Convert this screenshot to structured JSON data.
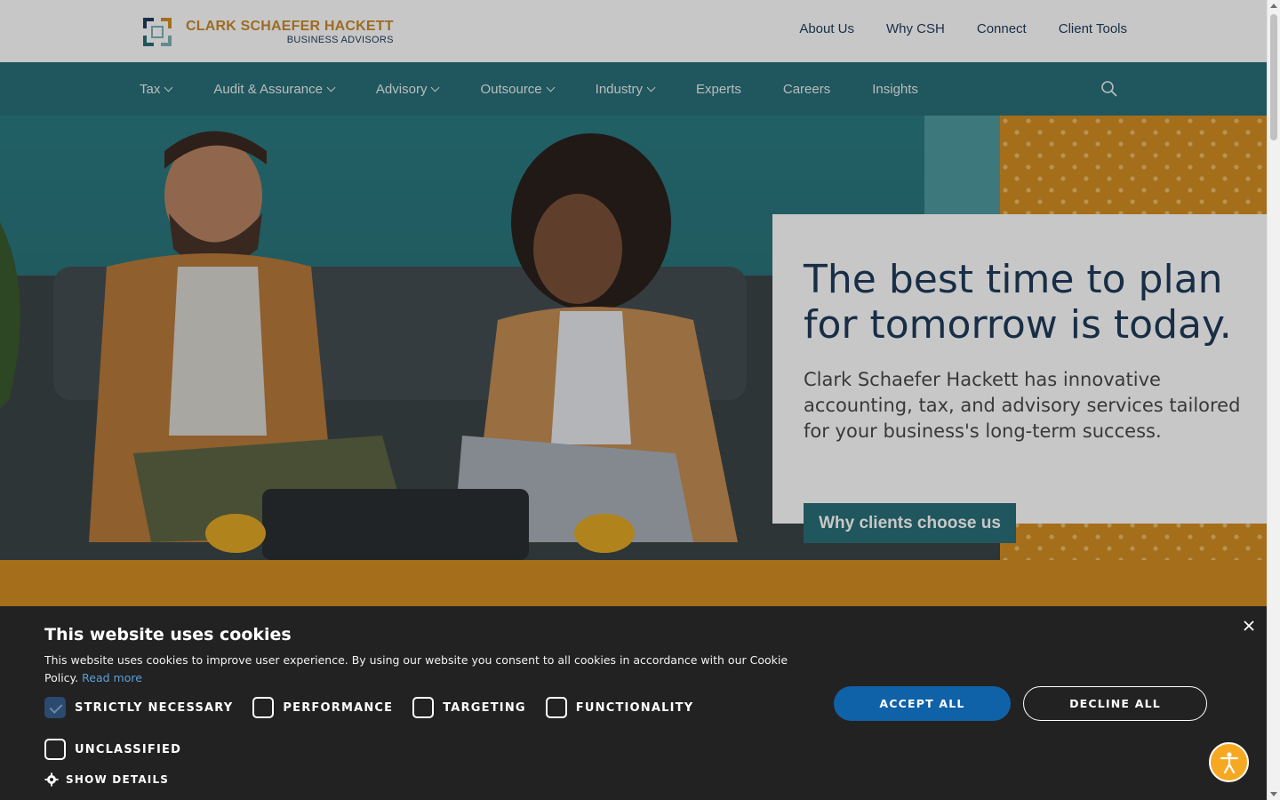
{
  "brand": {
    "name": "CLARK SCHAEFER HACKETT",
    "tagline": "BUSINESS ADVISORS"
  },
  "utility_nav": [
    "About Us",
    "Why CSH",
    "Connect",
    "Client Tools"
  ],
  "main_nav": [
    {
      "label": "Tax",
      "dropdown": true
    },
    {
      "label": "Audit & Assurance",
      "dropdown": true
    },
    {
      "label": "Advisory",
      "dropdown": true
    },
    {
      "label": "Outsource",
      "dropdown": true
    },
    {
      "label": "Industry",
      "dropdown": true
    },
    {
      "label": "Experts",
      "dropdown": false
    },
    {
      "label": "Careers",
      "dropdown": false
    },
    {
      "label": "Insights",
      "dropdown": false
    }
  ],
  "hero": {
    "title": "The best time to plan for tomorrow is today.",
    "text": "Clark Schaefer Hackett has innovative accounting, tax, and advisory services tailored for your business's long-term success.",
    "cta": "Why clients choose us"
  },
  "cookie": {
    "title": "This website uses cookies",
    "description": "This website uses cookies to improve user experience. By using our website you consent to all cookies in accordance with our Cookie Policy.",
    "read_more": "Read more",
    "categories": [
      {
        "label": "STRICTLY NECESSARY",
        "checked": true
      },
      {
        "label": "PERFORMANCE",
        "checked": false
      },
      {
        "label": "TARGETING",
        "checked": false
      },
      {
        "label": "FUNCTIONALITY",
        "checked": false
      },
      {
        "label": "UNCLASSIFIED",
        "checked": false
      }
    ],
    "show_details": "SHOW DETAILS",
    "accept_all": "ACCEPT ALL",
    "decline_all": "DECLINE ALL"
  },
  "colors": {
    "navy": "#1f3b5a",
    "teal": "#2a6f78",
    "gold": "#d48e22",
    "accept_blue": "#1062a8",
    "banner_bg": "#222222"
  }
}
